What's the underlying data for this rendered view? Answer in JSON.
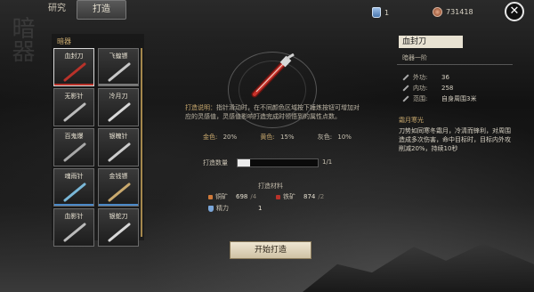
{
  "tabs": [
    {
      "label": "研究",
      "active": false
    },
    {
      "label": "打造",
      "active": true
    }
  ],
  "resources": {
    "bottle": {
      "icon": "potion-bottle-icon",
      "value": "1"
    },
    "coin": {
      "icon": "copper-coin-icon",
      "value": "731418"
    }
  },
  "watermark": "暗器",
  "left_panel": {
    "section_label": "暗器",
    "items": [
      {
        "name": "血封刀",
        "selected": true,
        "weapon_color": "#b8322a",
        "bar_color": "#b8322a"
      },
      {
        "name": "飞蝗镖",
        "selected": false,
        "weapon_color": "#c8c8c8",
        "bar_color": "#7a7a7a"
      },
      {
        "name": "无影针",
        "selected": false,
        "weapon_color": "#bbbbbb",
        "bar_color": ""
      },
      {
        "name": "冷月刀",
        "selected": false,
        "weapon_color": "#d8d8d8",
        "bar_color": ""
      },
      {
        "name": "百鬼爆",
        "selected": false,
        "weapon_color": "#a8a8a8",
        "bar_color": ""
      },
      {
        "name": "银魄针",
        "selected": false,
        "weapon_color": "#cccccc",
        "bar_color": ""
      },
      {
        "name": "魂雨针",
        "selected": false,
        "weapon_color": "#7ab8d8",
        "bar_color": "#4a88c8"
      },
      {
        "name": "金钱镖",
        "selected": false,
        "weapon_color": "#c9a96e",
        "bar_color": "#4a88c8"
      },
      {
        "name": "血影针",
        "selected": false,
        "weapon_color": "#bbbbbb",
        "bar_color": ""
      },
      {
        "name": "银蛇刀",
        "selected": false,
        "weapon_color": "#d8d8d8",
        "bar_color": ""
      }
    ]
  },
  "center": {
    "description_label": "打造说明：",
    "description_text": "指针滑动时，在不同颜色区域按下锤炼按钮可增加对应的灵感值，灵感值影响打造完成时领悟到的属性点数。",
    "stats": [
      {
        "label": "金色:",
        "value": "20%"
      },
      {
        "label": "黄色:",
        "value": "15%"
      },
      {
        "label": "灰色:",
        "value": "10%"
      }
    ],
    "quantity_label": "打造数量",
    "quantity_value": "1/1",
    "quantity_fraction": 0.15,
    "materials_title": "打造材料",
    "materials": {
      "copper": {
        "name": "铜矿",
        "value": "698",
        "need": "/4"
      },
      "iron": {
        "name": "铁矿",
        "value": "874",
        "need": "/2"
      },
      "energy": {
        "name": "精力",
        "value": "1"
      }
    },
    "craft_button": "开始打造"
  },
  "right_panel": {
    "name": "血封刀",
    "subtitle": "暗器一阶",
    "stats": [
      {
        "label": "外功:",
        "value": "36"
      },
      {
        "label": "内功:",
        "value": "258"
      },
      {
        "label": "范围:",
        "value": "自身周围3米"
      }
    ],
    "skill_title": "霜月寒光",
    "skill_desc": "刀势如同寒冬霜月，冷清而锋利，对周围造成多次伤害，命中目标时，目标内外攻削减20%，持续10秒"
  }
}
